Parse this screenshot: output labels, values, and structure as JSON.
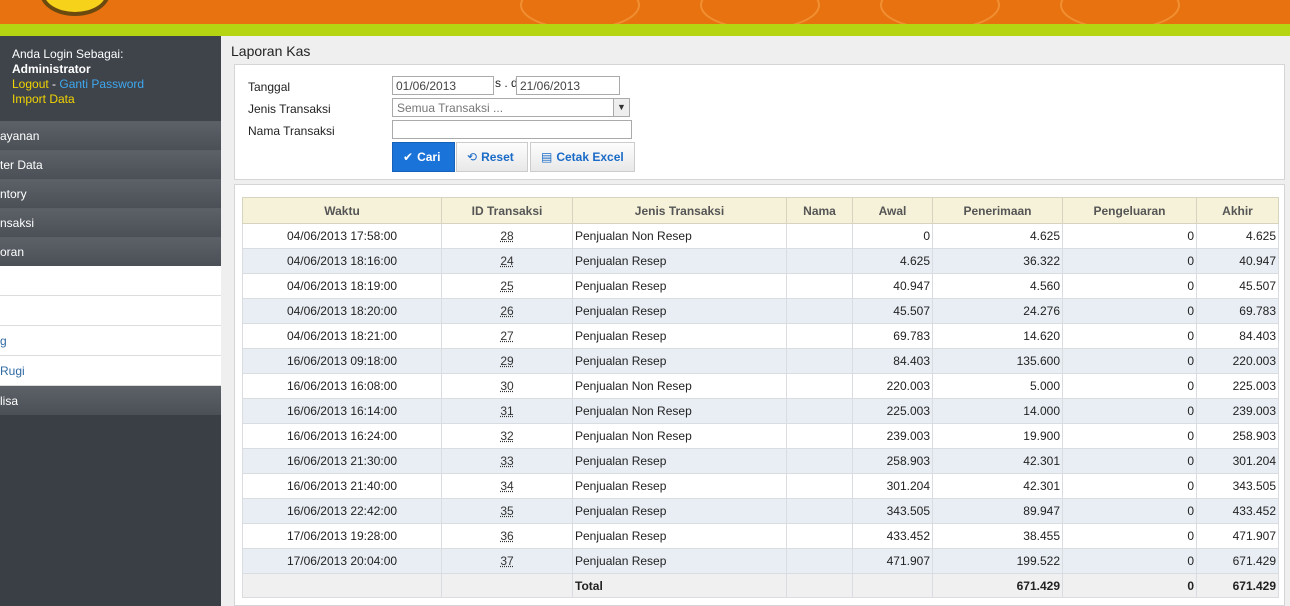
{
  "sidebar": {
    "login_prefix": "Anda Login Sebagai:",
    "user": "Administrator",
    "logout": "Logout",
    "separator": " - ",
    "change_password": "Ganti Password",
    "import": "Import Data",
    "nav": [
      "ayanan",
      "ter Data",
      "ntory",
      "nsaksi",
      "oran"
    ],
    "sub": [
      "",
      "",
      "g",
      "Rugi"
    ],
    "nav_after": "lisa"
  },
  "page": {
    "title": "Laporan Kas"
  },
  "form": {
    "tanggal_label": "Tanggal",
    "date_from": "01/06/2013",
    "date_sep": "s . d",
    "date_to": "21/06/2013",
    "jenis_label": "Jenis Transaksi",
    "jenis_value": "Semua Transaksi ...",
    "nama_label": "Nama Transaksi",
    "nama_value": "",
    "btn_cari": "Cari",
    "btn_reset": "Reset",
    "btn_excel": "Cetak Excel"
  },
  "table": {
    "headers": [
      "Waktu",
      "ID Transaksi",
      "Jenis Transaksi",
      "Nama",
      "Awal",
      "Penerimaan",
      "Pengeluaran",
      "Akhir"
    ],
    "rows": [
      [
        "04/06/2013 17:58:00",
        "28",
        "Penjualan Non Resep",
        "",
        "0",
        "4.625",
        "0",
        "4.625"
      ],
      [
        "04/06/2013 18:16:00",
        "24",
        "Penjualan Resep",
        "",
        "4.625",
        "36.322",
        "0",
        "40.947"
      ],
      [
        "04/06/2013 18:19:00",
        "25",
        "Penjualan Resep",
        "",
        "40.947",
        "4.560",
        "0",
        "45.507"
      ],
      [
        "04/06/2013 18:20:00",
        "26",
        "Penjualan Resep",
        "",
        "45.507",
        "24.276",
        "0",
        "69.783"
      ],
      [
        "04/06/2013 18:21:00",
        "27",
        "Penjualan Resep",
        "",
        "69.783",
        "14.620",
        "0",
        "84.403"
      ],
      [
        "16/06/2013 09:18:00",
        "29",
        "Penjualan Resep",
        "",
        "84.403",
        "135.600",
        "0",
        "220.003"
      ],
      [
        "16/06/2013 16:08:00",
        "30",
        "Penjualan Non Resep",
        "",
        "220.003",
        "5.000",
        "0",
        "225.003"
      ],
      [
        "16/06/2013 16:14:00",
        "31",
        "Penjualan Non Resep",
        "",
        "225.003",
        "14.000",
        "0",
        "239.003"
      ],
      [
        "16/06/2013 16:24:00",
        "32",
        "Penjualan Non Resep",
        "",
        "239.003",
        "19.900",
        "0",
        "258.903"
      ],
      [
        "16/06/2013 21:30:00",
        "33",
        "Penjualan Resep",
        "",
        "258.903",
        "42.301",
        "0",
        "301.204"
      ],
      [
        "16/06/2013 21:40:00",
        "34",
        "Penjualan Resep",
        "",
        "301.204",
        "42.301",
        "0",
        "343.505"
      ],
      [
        "16/06/2013 22:42:00",
        "35",
        "Penjualan Resep",
        "",
        "343.505",
        "89.947",
        "0",
        "433.452"
      ],
      [
        "17/06/2013 19:28:00",
        "36",
        "Penjualan Resep",
        "",
        "433.452",
        "38.455",
        "0",
        "471.907"
      ],
      [
        "17/06/2013 20:04:00",
        "37",
        "Penjualan Resep",
        "",
        "471.907",
        "199.522",
        "0",
        "671.429"
      ]
    ],
    "total_label": "Total",
    "total_penerimaan": "671.429",
    "total_pengeluaran": "0",
    "total_akhir": "671.429"
  },
  "colors": {
    "header_orange": "#e8720f",
    "accent_green": "#b5d513",
    "primary_button": "#1a73d9"
  }
}
